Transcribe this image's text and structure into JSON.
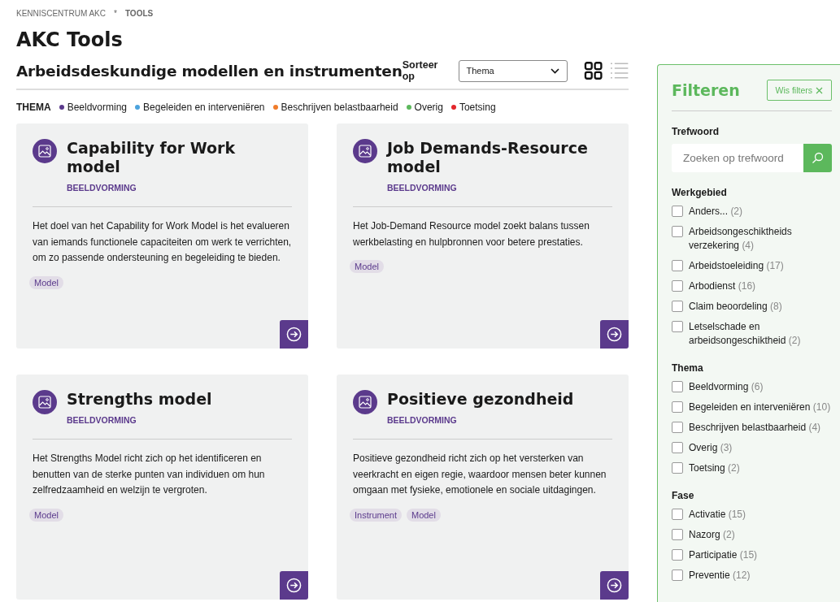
{
  "breadcrumb": [
    "KENNISCENTRUM AKC",
    "*",
    "TOOLS"
  ],
  "page_title": "AKC Tools",
  "section_title": "Arbeidsdeskundige modellen en instrumenten",
  "sort": {
    "label": "Sorteer op",
    "value": "Thema"
  },
  "view_toggle": [
    {
      "kind": "grid",
      "selected": true
    },
    {
      "kind": "list",
      "selected": false
    }
  ],
  "legend": {
    "label": "THEMA",
    "items": [
      {
        "name": "Beeldvorming",
        "color": "#5b3a8c"
      },
      {
        "name": "Begeleiden en interveniëren",
        "color": "#4ca3dd"
      },
      {
        "name": "Beschrijven belastbaarheid",
        "color": "#f07c2a"
      },
      {
        "name": "Overig",
        "color": "#5cb85c"
      },
      {
        "name": "Toetsing",
        "color": "#e3262b"
      }
    ]
  },
  "cards": [
    {
      "title": "Capability for Work model",
      "category": "BEELDVORMING",
      "description": "Het doel van het Capability for Work Model is het evalueren van iemands functionele capaciteiten om werk te verrichten, om zo passende ondersteuning en begeleiding te bieden.",
      "tags": [
        "Model"
      ]
    },
    {
      "title": "Job Demands-Resource model",
      "category": "BEELDVORMING",
      "description": "Het Job-Demand Resource model zoekt balans tussen werkbelasting en hulpbronnen voor betere prestaties.",
      "tags": [
        "Model"
      ]
    },
    {
      "title": "Strengths model",
      "category": "BEELDVORMING",
      "description": "Het Strengths Model richt zich op het identificeren en benutten van de sterke punten van individuen om hun zelfredzaamheid en welzijn te vergroten.",
      "tags": [
        "Model"
      ]
    },
    {
      "title": "Positieve gezondheid",
      "category": "BEELDVORMING",
      "description": "Positieve gezondheid richt zich op het versterken van veerkracht en eigen regie, waardoor mensen beter kunnen omgaan met fysieke, emotionele en sociale uitdagingen.",
      "tags": [
        "Instrument",
        "Model"
      ]
    }
  ],
  "filters": {
    "title": "Filteren",
    "clear_button": "Wis filters",
    "keyword": {
      "label": "Trefwoord",
      "placeholder": "Zoeken op trefwoord"
    },
    "groups": [
      {
        "label": "Werkgebied",
        "options": [
          {
            "name": "Anders...",
            "count": "(2)",
            "checked": false
          },
          {
            "name": "Arbeidsongeschiktheids verzekering",
            "count": "(4)",
            "checked": false
          },
          {
            "name": "Arbeidstoeleiding",
            "count": "(17)",
            "checked": false
          },
          {
            "name": "Arbodienst",
            "count": "(16)",
            "checked": false
          },
          {
            "name": "Claim beoordeling",
            "count": "(8)",
            "checked": false
          },
          {
            "name": "Letselschade en arbeidsongeschiktheid",
            "count": "(2)",
            "checked": false
          }
        ]
      },
      {
        "label": "Thema",
        "options": [
          {
            "name": "Beeldvorming",
            "count": "(6)",
            "checked": false
          },
          {
            "name": "Begeleiden en interveniëren",
            "count": "(10)",
            "checked": false
          },
          {
            "name": "Beschrijven belastbaarheid",
            "count": "(4)",
            "checked": false
          },
          {
            "name": "Overig",
            "count": "(3)",
            "checked": false
          },
          {
            "name": "Toetsing",
            "count": "(2)",
            "checked": false
          }
        ]
      },
      {
        "label": "Fase",
        "options": [
          {
            "name": "Activatie",
            "count": "(15)",
            "checked": false
          },
          {
            "name": "Nazorg",
            "count": "(2)",
            "checked": false
          },
          {
            "name": "Participatie",
            "count": "(15)",
            "checked": false
          },
          {
            "name": "Preventie",
            "count": "(12)",
            "checked": false
          }
        ]
      }
    ]
  }
}
